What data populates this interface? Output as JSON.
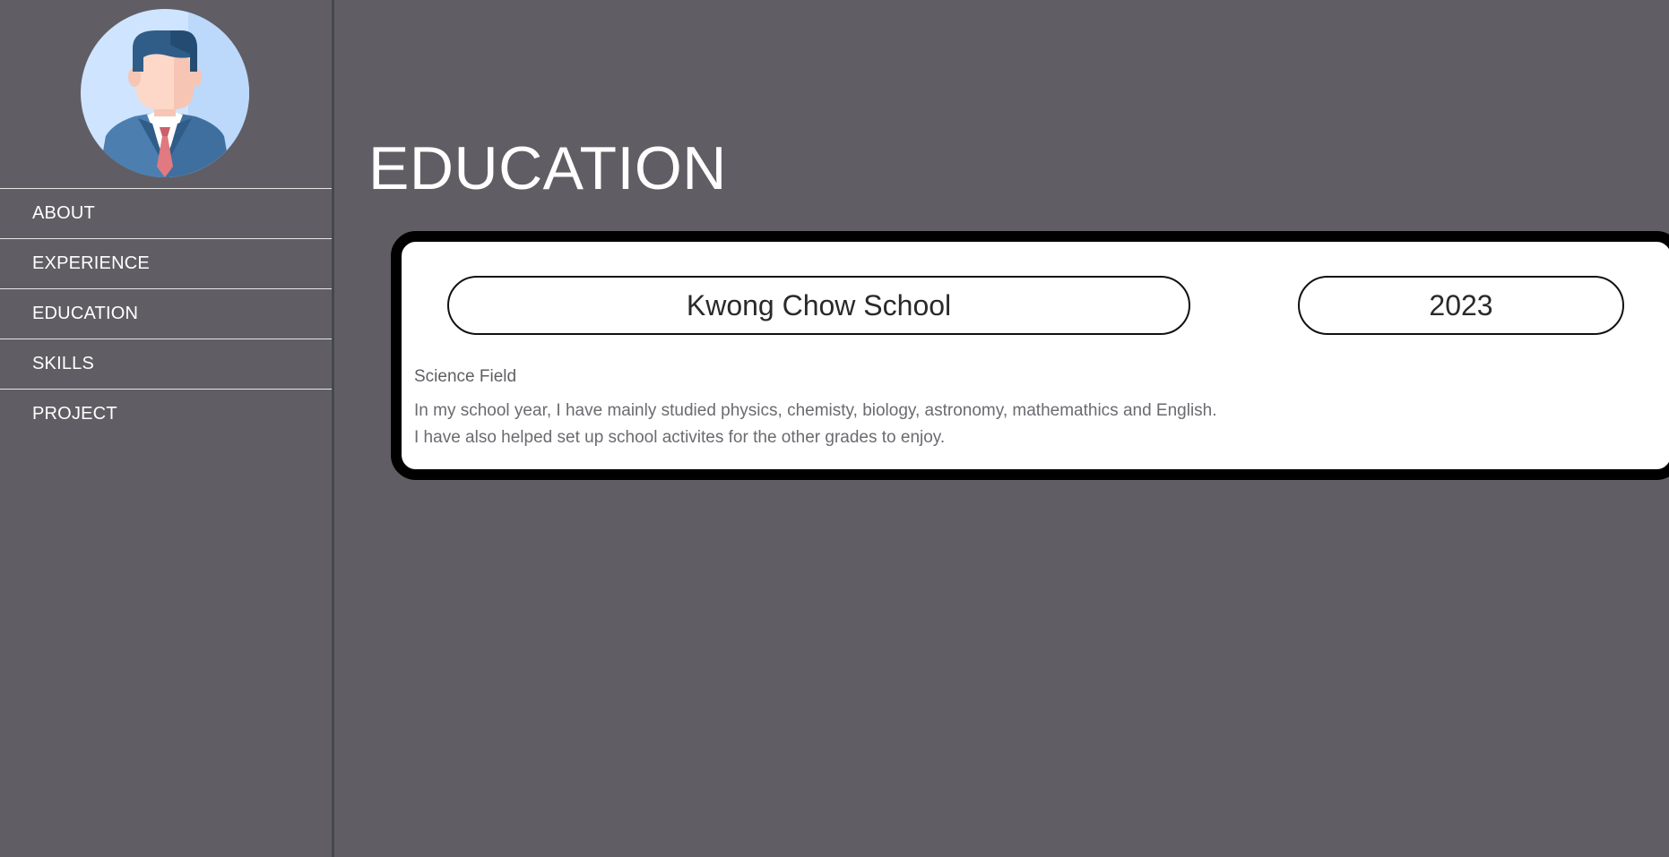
{
  "sidebar": {
    "avatar_icon": "businessman-avatar-icon",
    "items": [
      {
        "label": "ABOUT"
      },
      {
        "label": "EXPERIENCE"
      },
      {
        "label": "EDUCATION"
      },
      {
        "label": "SKILLS"
      },
      {
        "label": "PROJECT"
      }
    ]
  },
  "main": {
    "title": "EDUCATION",
    "entries": [
      {
        "school": "Kwong Chow School",
        "year": "2023",
        "field": "Science Field",
        "description": "In my school year, I have mainly studied physics, chemisty, biology, astronomy, mathemathics and English. I have also helped set up school activites for the other grades to enjoy."
      }
    ]
  },
  "colors": {
    "background": "#605e64",
    "card": "#ffffff",
    "card_border": "#000000",
    "avatar_bg": "#cfe4ff",
    "suit": "#3f6f9e",
    "tie": "#e07a80"
  }
}
